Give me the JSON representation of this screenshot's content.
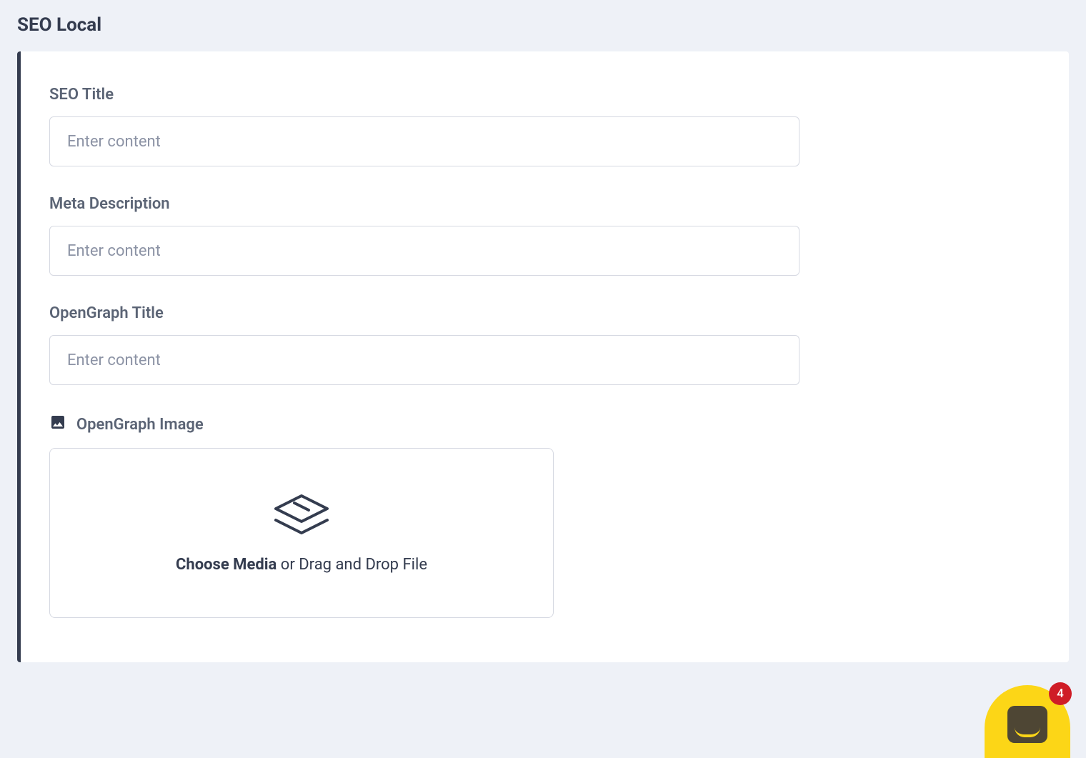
{
  "header": {
    "title": "SEO Local"
  },
  "form": {
    "seo_title": {
      "label": "SEO Title",
      "placeholder": "Enter content",
      "value": ""
    },
    "meta_description": {
      "label": "Meta Description",
      "placeholder": "Enter content",
      "value": ""
    },
    "og_title": {
      "label": "OpenGraph Title",
      "placeholder": "Enter content",
      "value": ""
    },
    "og_image": {
      "label": "OpenGraph Image",
      "choose_text": "Choose Media",
      "drag_text": " or Drag and Drop File"
    }
  },
  "chat": {
    "badge_count": "4"
  }
}
